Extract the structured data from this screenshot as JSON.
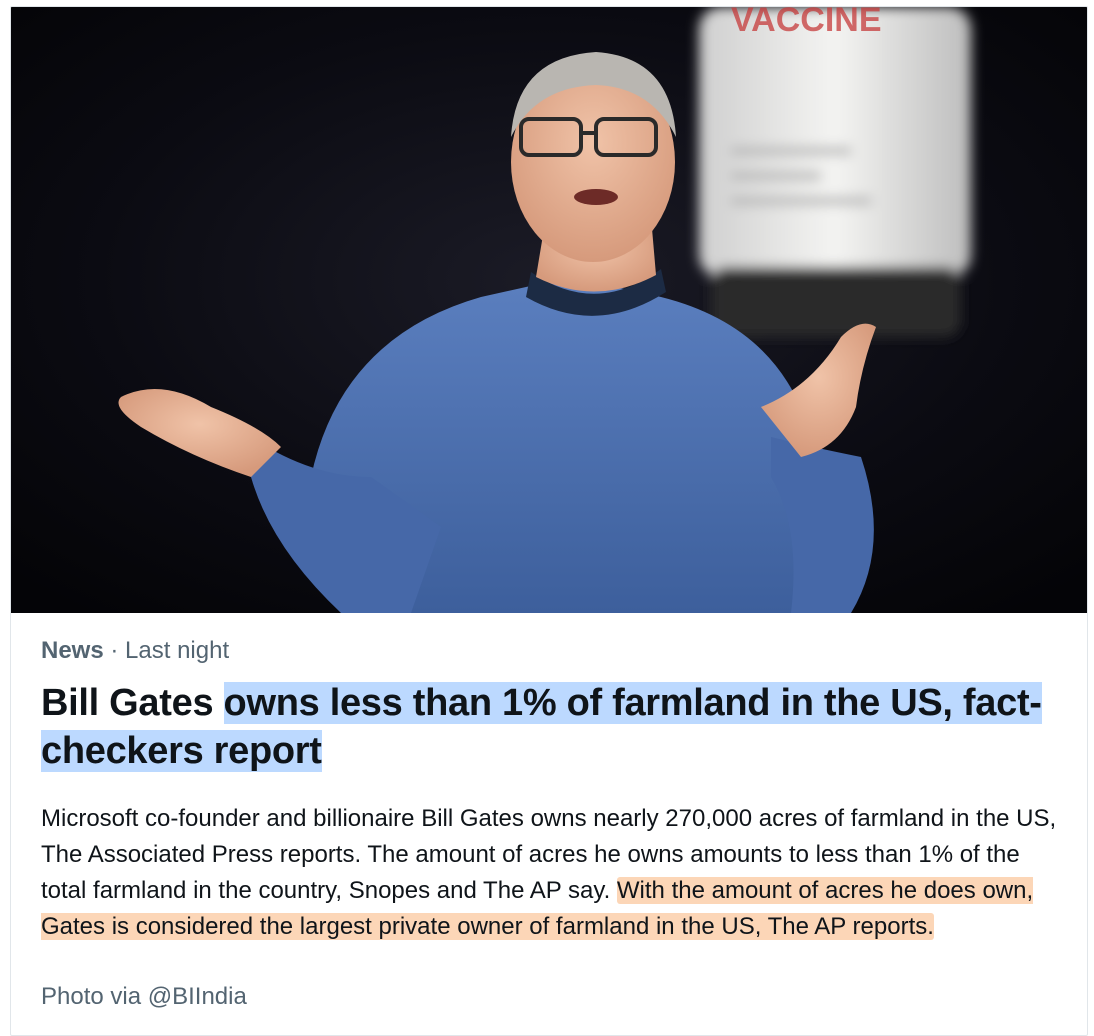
{
  "card": {
    "source": "News",
    "separator": " · ",
    "time": "Last night",
    "headline_plain": "Bill Gates ",
    "headline_highlight": "owns less than 1% of farmland in the US, fact-checkers report",
    "body_plain": "Microsoft co-founder and billionaire Bill Gates owns nearly 270,000 acres of farmland in the US, The Associated Press reports. The amount of acres he owns amounts to less than 1% of the total farmland in the country, Snopes and The AP say. ",
    "body_highlight": "With the amount of acres he does own, Gates is considered the largest private owner of farmland in the US, The AP reports.",
    "photo_credit": "Photo via @BIIndia",
    "bottle_label": "VACCINE"
  },
  "colors": {
    "headline_highlight": "#bcd9ff",
    "body_highlight": "#fcd6b7",
    "meta_text": "#536471",
    "sweater": "#4a6fb0"
  }
}
